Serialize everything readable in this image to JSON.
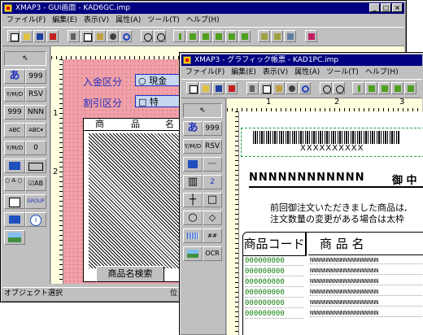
{
  "back_window": {
    "title": "XMAP3 - GUI画面 - KAD6GC.imp",
    "menu": [
      "ファイル(F)",
      "編集(E)",
      "表示(V)",
      "属性(A)",
      "ツール(T)",
      "ヘルプ(H)"
    ],
    "palette": {
      "hiragana": "あ",
      "num": "999",
      "ymd": "Y/M/D",
      "rsv": "RSV",
      "box999": "999",
      "nnn": "NNN",
      "abc": "ABC",
      "abc_dd": "ABC▾",
      "ymd2": "Y/M/D",
      "zero": "0",
      "radio": "○ A\n○ B",
      "check": "☑AB",
      "group": "GROUP"
    },
    "ruler_marks": [
      "1",
      "2"
    ],
    "form": {
      "row1_label": "入金区分",
      "row1_opt": "○ 現金",
      "row2_label": "割引区分",
      "row2_opt": "□ 特",
      "header_col1": "商",
      "header_col2": "品",
      "header_col3": "名",
      "search_button": "商品名検索"
    },
    "status": "オブジェクト選択",
    "status_right": "位"
  },
  "front_window": {
    "title": "XMAP3 - グラフィック帳票 - KAD1PC.imp",
    "menu": [
      "ファイル(F)",
      "編集(E)",
      "表示(V)",
      "属性(A)",
      "ツール(T)",
      "ヘルプ(H)"
    ],
    "palette": {
      "hiragana": "あ",
      "num": "999",
      "ymd": "Y/M/D",
      "rsv": "RSV",
      "num2": "2",
      "num_bar": "##",
      "ocr": "OCR"
    },
    "ruler_marks": [
      "1",
      "2",
      "3"
    ],
    "form": {
      "barcode_text": "XXXXXXXXXX",
      "nnn_line": "NNNNNNNNNNNN",
      "honor": "御 中",
      "notice1": "前回御注文いただきました商品は,",
      "notice2": "注文数量の変更がある場合は太枠",
      "col_code": "商品コード",
      "col_name": "商 品 名",
      "rows": [
        {
          "code": "000000000",
          "name": "NNNNNNNNNNNNNNNNNNNN"
        },
        {
          "code": "000000000",
          "name": "NNNNNNNNNNNNNNNNNNNN"
        },
        {
          "code": "000000000",
          "name": "NNNNNNNNNNNNNNNNNNNN"
        },
        {
          "code": "000000000",
          "name": "NNNNNNNNNNNNNNNNNNNN"
        },
        {
          "code": "000000000",
          "name": "NNNNNNNNNNNNNNNNNNNN"
        },
        {
          "code": "000000000",
          "name": "NNNNNNNNNNNNNNNNNNNN"
        }
      ]
    }
  },
  "colors": {
    "titlebar": "#000080",
    "pink": "#f0a0a8",
    "blue_text": "#2030c0",
    "green_code": "#108010"
  }
}
